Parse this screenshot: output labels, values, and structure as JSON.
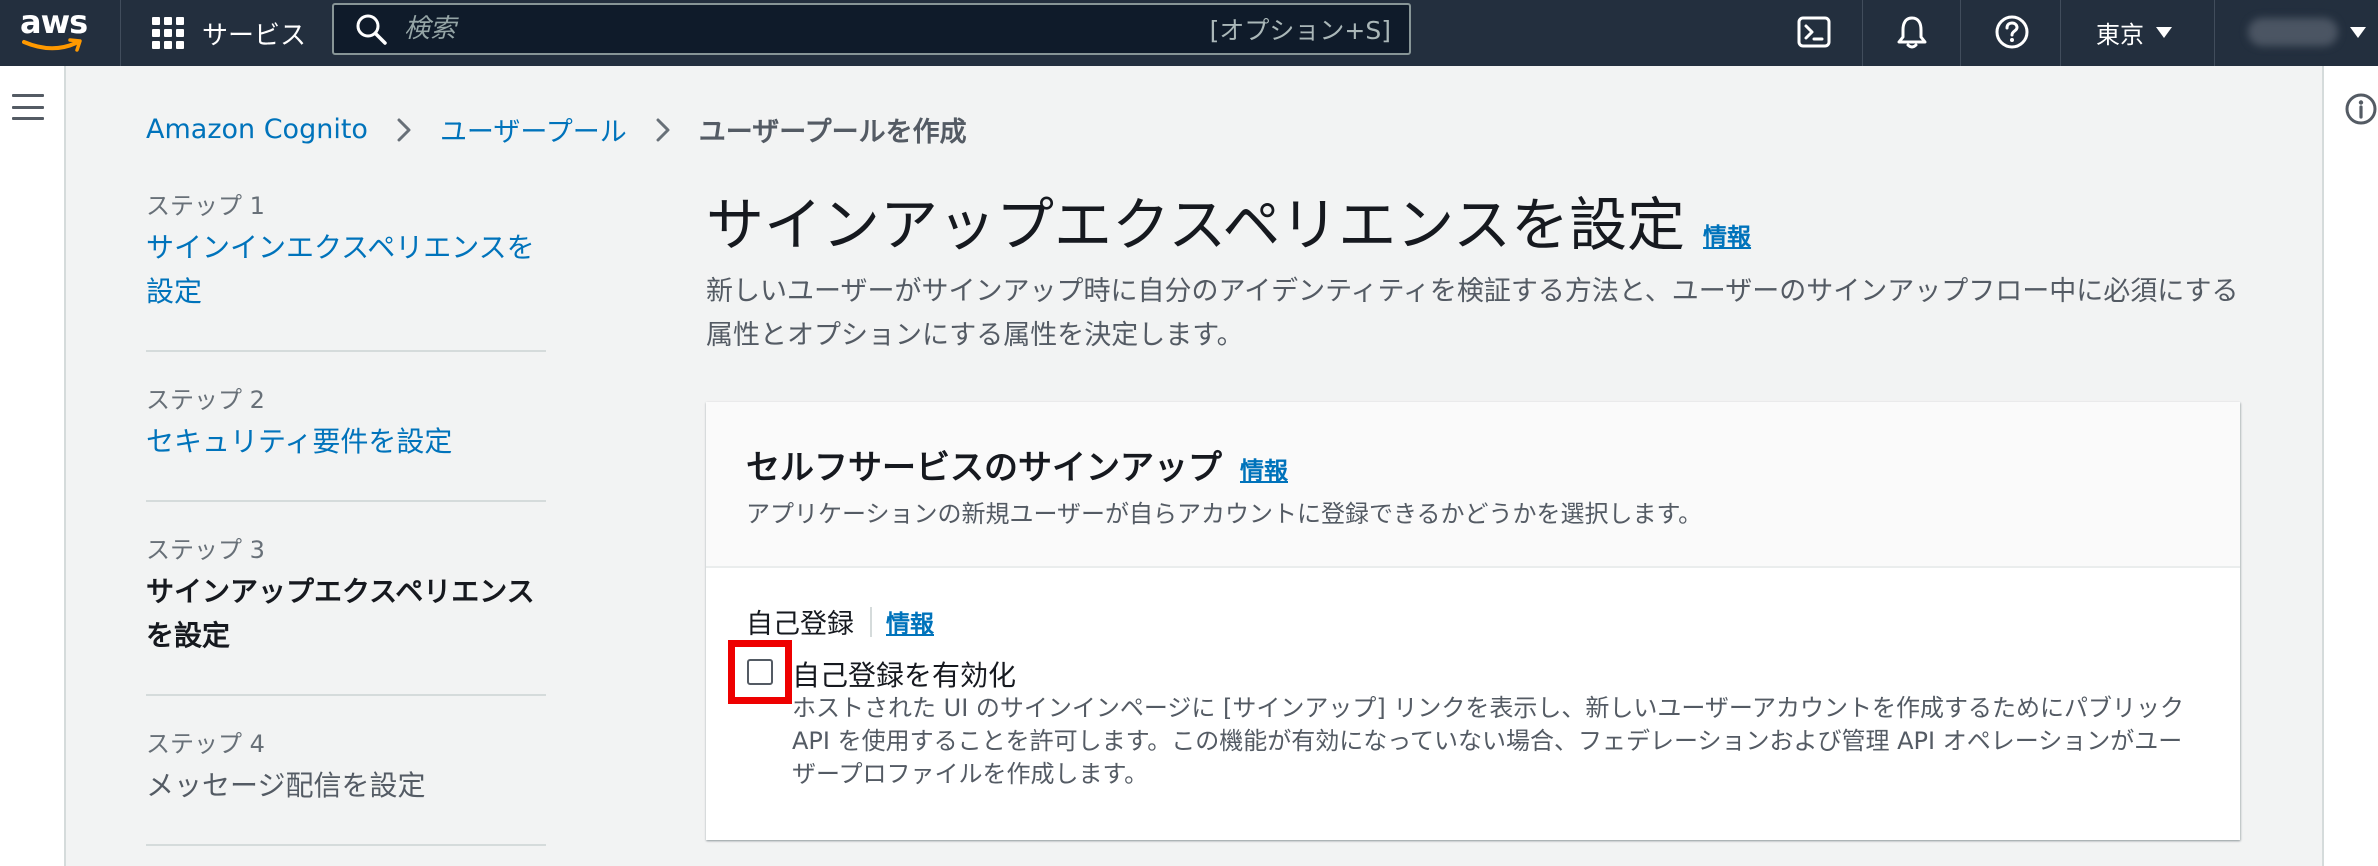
{
  "topnav": {
    "logo_text": "aws",
    "services_label": "サービス",
    "search_placeholder": "検索",
    "search_shortcut": "[オプション+S]",
    "region_label": "東京"
  },
  "breadcrumb": {
    "items": [
      "Amazon Cognito",
      "ユーザープール"
    ],
    "current": "ユーザープールを作成"
  },
  "steps": [
    {
      "number": "ステップ 1",
      "label": "サインインエクスペリエンスを設定",
      "state": "link"
    },
    {
      "number": "ステップ 2",
      "label": "セキュリティ要件を設定",
      "state": "link"
    },
    {
      "number": "ステップ 3",
      "label": "サインアップエクスペリエンスを設定",
      "state": "active"
    },
    {
      "number": "ステップ 4",
      "label": "メッセージ配信を設定",
      "state": "disabled"
    }
  ],
  "page": {
    "title": "サインアップエクスペリエンスを設定",
    "info_label": "情報",
    "description": "新しいユーザーがサインアップ時に自分のアイデンティティを検証する方法と、ユーザーのサインアップフロー中に必須にする属性とオプションにする属性を決定します。"
  },
  "self_service": {
    "title": "セルフサービスのサインアップ",
    "info_label": "情報",
    "description": "アプリケーションの新規ユーザーが自らアカウントに登録できるかどうかを選択します。",
    "field_label": "自己登録",
    "field_info_label": "情報",
    "checkbox_label": "自己登録を有効化",
    "checkbox_checked": false,
    "checkbox_description": "ホストされた UI のサインインページに [サインアップ] リンクを表示し、新しいユーザーアカウントを作成するためにパブリック API を使用することを許可します。この機能が有効になっていない場合、フェデレーションおよび管理 API オペレーションがユーザープロファイルを作成します。"
  },
  "colors": {
    "nav_bg": "#232f3e",
    "link": "#0073bb",
    "highlight_box": "#ee0000",
    "aws_smile": "#ff9900"
  }
}
